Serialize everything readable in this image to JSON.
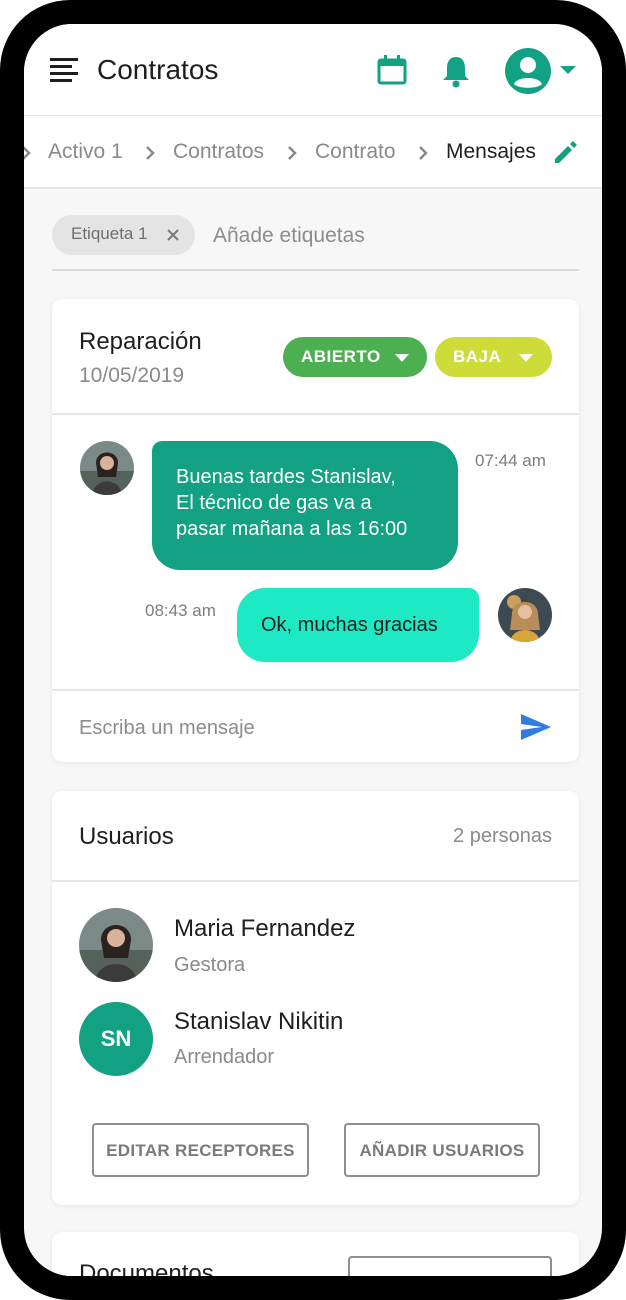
{
  "app_bar": {
    "title": "Contratos",
    "icons": [
      "menu-icon",
      "calendar-icon",
      "bell-icon",
      "account-circle-icon",
      "caret-down-icon"
    ]
  },
  "breadcrumb": {
    "items": [
      "Activo 1",
      "Contratos",
      "Contrato",
      "Mensajes"
    ],
    "current": "Mensajes",
    "edit_icon": "pencil-icon"
  },
  "tags": {
    "chips": [
      {
        "label": "Etiqueta 1"
      }
    ],
    "placeholder": "Añade etiquetas"
  },
  "ticket": {
    "title": "Reparación",
    "date": "10/05/2019",
    "status": "ABIERTO",
    "priority": "BAJA",
    "messages": [
      {
        "direction": "incoming",
        "lines": [
          "Buenas tardes Stanislav,",
          "El técnico de gas va a",
          "pasar mañana a las 16:00"
        ],
        "time": "07:44 am"
      },
      {
        "direction": "outgoing",
        "lines": [
          "Ok, muchas gracias"
        ],
        "time": "08:43 am"
      }
    ],
    "input_placeholder": "Escriba un mensaje"
  },
  "users": {
    "title": "Usuarios",
    "count": "2 personas",
    "list": [
      {
        "name": "Maria Fernandez",
        "role": "Gestora",
        "initials": ""
      },
      {
        "name": "Stanislav Nikitin",
        "role": "Arrendador",
        "initials": "SN"
      }
    ],
    "edit_button": "EDITAR RECEPTORES",
    "add_button": "AÑADIR USUARIOS"
  },
  "documents": {
    "title": "Documentos"
  },
  "colors": {
    "brand": "#13a183",
    "status_open": "#4caf50",
    "priority_low": "#cddc39",
    "outgoing_bubble": "#1de9c4",
    "send": "#2f7de1"
  }
}
